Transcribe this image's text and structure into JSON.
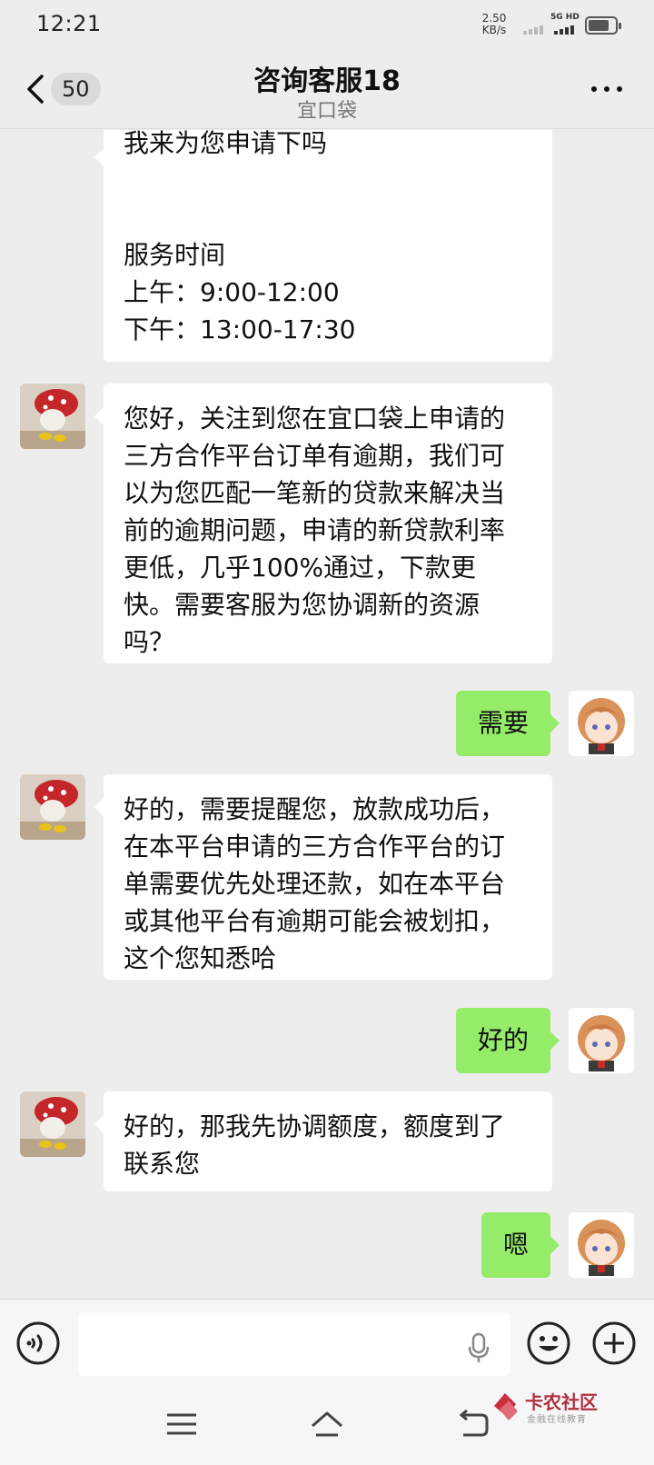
{
  "status_bar": {
    "time": "12:21",
    "net_speed_value": "2.50",
    "net_speed_unit": "KB/s",
    "network_type": "5G HD"
  },
  "header": {
    "unread_count": "50",
    "title": "咨询客服18",
    "subtitle": "宜口袋",
    "more_icon": "more-dots-icon"
  },
  "messages": [
    {
      "side": "left",
      "text": "我来为您申请下吗\n\n\n服务时间\n上午：9:00-12:00\n下午：13:00-17:30"
    },
    {
      "side": "left",
      "text": "您好，关注到您在宜口袋上申请的\n三方合作平台订单有逾期，我们可\n以为您匹配一笔新的贷款来解决当\n前的逾期问题，申请的新贷款利率\n更低，几乎100%通过，下款更\n快。需要客服为您协调新的资源\n吗？"
    },
    {
      "side": "right",
      "text": "需要"
    },
    {
      "side": "left",
      "text": "好的，需要提醒您，放款成功后，\n在本平台申请的三方合作平台的订\n单需要优先处理还款，如在本平台\n或其他平台有逾期可能会被划扣，\n这个您知悉哈"
    },
    {
      "side": "right",
      "text": "好的"
    },
    {
      "side": "left",
      "text": "好的，那我先协调额度，额度到了\n联系您"
    },
    {
      "side": "right",
      "text": "嗯"
    }
  ],
  "input_bar": {
    "placeholder": ""
  },
  "watermark": {
    "name": "卡农社区",
    "tagline": "金融在线教育"
  },
  "colors": {
    "background": "#ededed",
    "my_bubble": "#95ec69",
    "their_bubble": "#ffffff"
  }
}
